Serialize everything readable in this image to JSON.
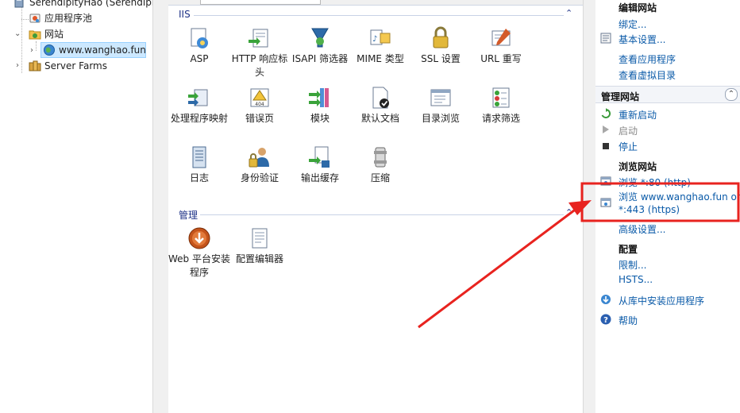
{
  "tree": {
    "server": "SerendipityHao (Serendipit",
    "app_pools": "应用程序池",
    "sites": "网站",
    "site": "www.wanghao.fun",
    "server_farms": "Server Farms"
  },
  "center": {
    "iis_section": "IIS",
    "manage_section": "管理",
    "iis_features": [
      {
        "label": "ASP",
        "icon": "asp-icon"
      },
      {
        "label": "HTTP 响应标头",
        "icon": "http-response-headers-icon"
      },
      {
        "label": "ISAPI 筛选器",
        "icon": "isapi-filters-icon"
      },
      {
        "label": "MIME 类型",
        "icon": "mime-types-icon"
      },
      {
        "label": "SSL 设置",
        "icon": "ssl-lock-icon"
      },
      {
        "label": "URL 重写",
        "icon": "url-rewrite-icon"
      },
      {
        "label": "处理程序映射",
        "icon": "handler-mappings-icon"
      },
      {
        "label": "错误页",
        "icon": "error-pages-icon"
      },
      {
        "label": "模块",
        "icon": "modules-icon"
      },
      {
        "label": "默认文档",
        "icon": "default-document-icon"
      },
      {
        "label": "目录浏览",
        "icon": "directory-browsing-icon"
      },
      {
        "label": "请求筛选",
        "icon": "request-filtering-icon"
      },
      {
        "label": "日志",
        "icon": "logging-icon"
      },
      {
        "label": "身份验证",
        "icon": "authentication-icon"
      },
      {
        "label": "输出缓存",
        "icon": "output-caching-icon"
      },
      {
        "label": "压缩",
        "icon": "compression-icon"
      }
    ],
    "manage_features": [
      {
        "label": "Web 平台安装程序",
        "icon": "web-platform-installer-icon"
      },
      {
        "label": "配置编辑器",
        "icon": "configuration-editor-icon"
      }
    ]
  },
  "actions": {
    "edit_site_header": "编辑网站",
    "bindings": "绑定...",
    "basic_settings": "基本设置...",
    "view_applications": "查看应用程序",
    "view_virtual_dirs": "查看虚拟目录",
    "manage_site_header": "管理网站",
    "restart": "重新启动",
    "start": "启动",
    "stop": "停止",
    "browse_header": "浏览网站",
    "browse_80": "浏览 *:80 (http)",
    "browse_443_line1": "浏览 www.wanghao.fun on",
    "browse_443_line2": "*:443 (https)",
    "advanced_settings": "高级设置...",
    "configure_header": "配置",
    "limits": "限制...",
    "hsts": "HSTS...",
    "install_from_gallery": "从库中安装应用程序",
    "help": "帮助"
  },
  "annotation": {
    "highlight_color": "#e8231f"
  }
}
